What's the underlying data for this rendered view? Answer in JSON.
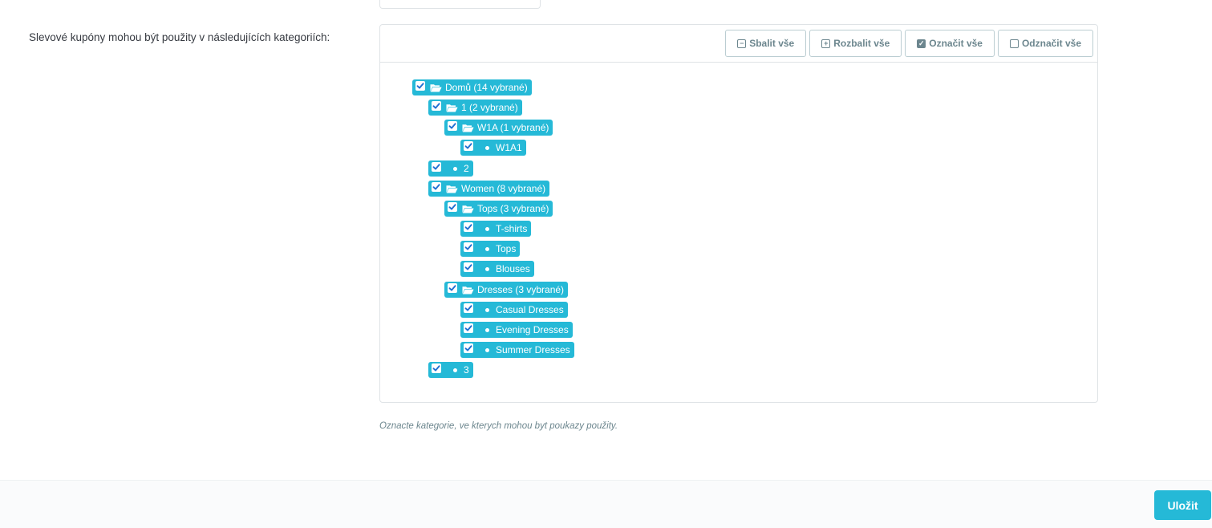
{
  "form": {
    "label": "Slevové kupóny mohou být použity v následujících kategoriích:",
    "hint": "Oznacte kategorie, ve kterych mohou byt poukazy použity."
  },
  "toolbar": {
    "collapse_all": "Sbalit vše",
    "expand_all": "Rozbalit vše",
    "check_all": "Označit vše",
    "uncheck_all": "Odznačit vše"
  },
  "tree": {
    "nodes": [
      {
        "label": "Domů (14 vybrané)",
        "depth": 0,
        "type": "folder",
        "checked": true
      },
      {
        "label": "1 (2 vybrané)",
        "depth": 1,
        "type": "folder",
        "checked": true
      },
      {
        "label": "W1A (1 vybrané)",
        "depth": 2,
        "type": "folder",
        "checked": true
      },
      {
        "label": "W1A1",
        "depth": 3,
        "type": "leaf",
        "checked": true
      },
      {
        "label": "2",
        "depth": 1,
        "type": "leaf",
        "checked": true
      },
      {
        "label": "Women (8 vybrané)",
        "depth": 1,
        "type": "folder",
        "checked": true
      },
      {
        "label": "Tops (3 vybrané)",
        "depth": 2,
        "type": "folder",
        "checked": true
      },
      {
        "label": "T-shirts",
        "depth": 3,
        "type": "leaf",
        "checked": true
      },
      {
        "label": "Tops",
        "depth": 3,
        "type": "leaf",
        "checked": true
      },
      {
        "label": "Blouses",
        "depth": 3,
        "type": "leaf",
        "checked": true
      },
      {
        "label": "Dresses (3 vybrané)",
        "depth": 2,
        "type": "folder",
        "checked": true
      },
      {
        "label": "Casual Dresses",
        "depth": 3,
        "type": "leaf",
        "checked": true
      },
      {
        "label": "Evening Dresses",
        "depth": 3,
        "type": "leaf",
        "checked": true
      },
      {
        "label": "Summer Dresses",
        "depth": 3,
        "type": "leaf",
        "checked": true
      },
      {
        "label": "3",
        "depth": 1,
        "type": "leaf",
        "checked": true
      }
    ]
  },
  "footer": {
    "save_label": "Uložit"
  },
  "colors": {
    "accent": "#25b9d7",
    "text": "#363a41",
    "muted": "#6c868e"
  },
  "icons": {
    "collapse": "minus-square-icon",
    "expand": "plus-square-icon",
    "check": "check-square-icon",
    "uncheck": "square-icon",
    "folder": "folder-open-icon",
    "leaf": "bullet-icon"
  }
}
